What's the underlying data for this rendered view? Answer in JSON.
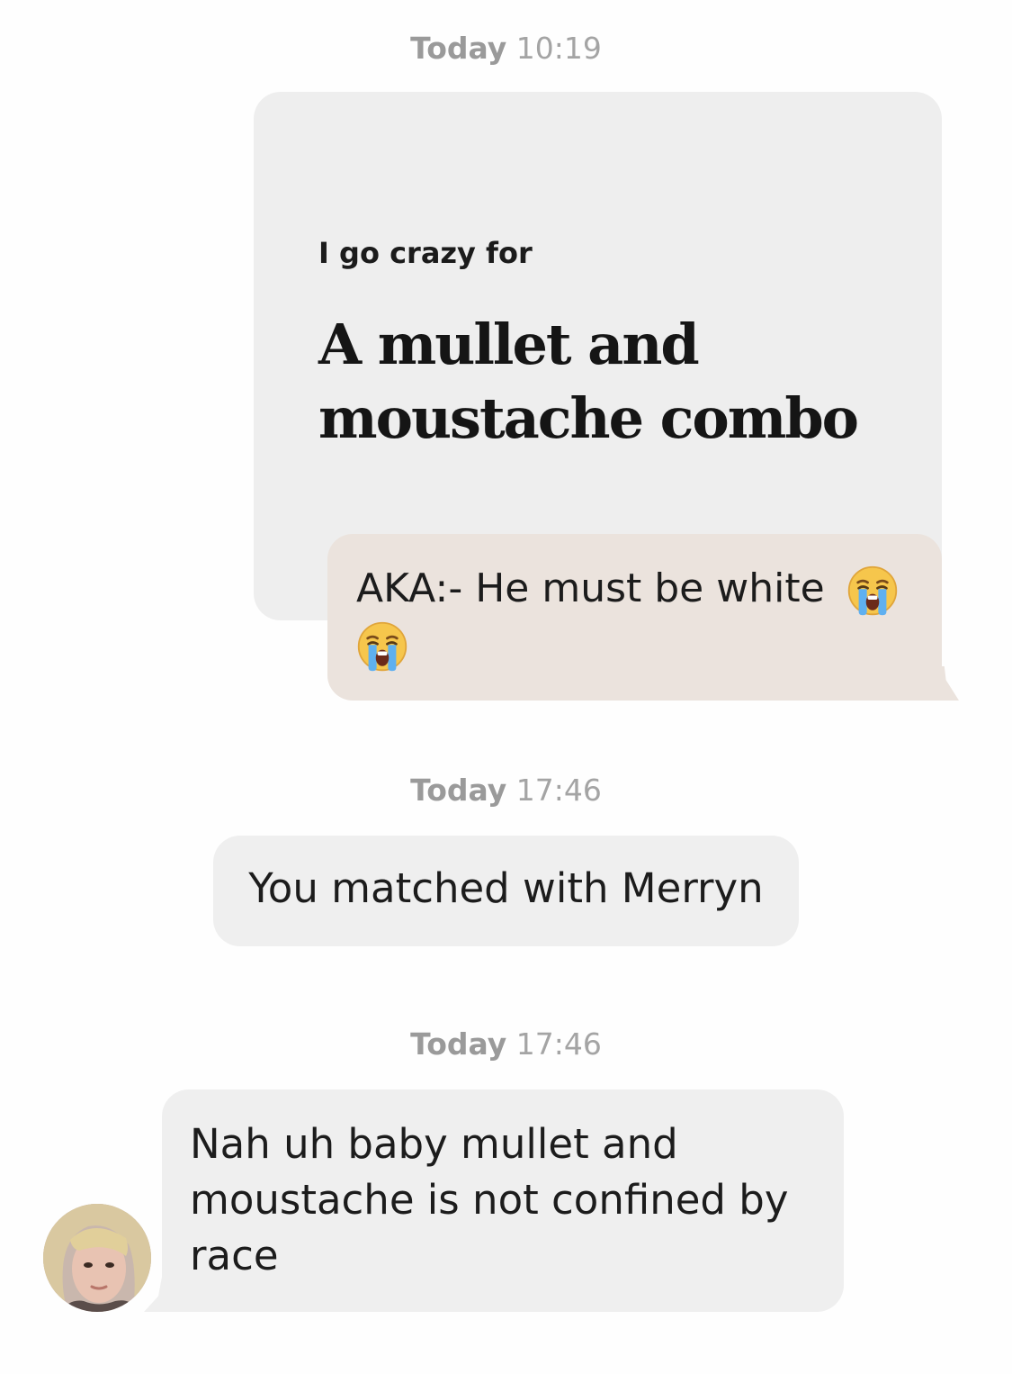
{
  "messages": {
    "ts1": {
      "day": "Today",
      "time": "10:19"
    },
    "prompt": {
      "question": "I go crazy for",
      "answer": "A mullet and moustache combo"
    },
    "reply": {
      "text": "AKA:- He must be white",
      "emojis": [
        "loudly-crying-face",
        "loudly-crying-face"
      ]
    },
    "ts2": {
      "day": "Today",
      "time": "17:46"
    },
    "system": {
      "text": "You matched with Merryn"
    },
    "ts3": {
      "day": "Today",
      "time": "17:46"
    },
    "received": {
      "text": "Nah uh baby mullet and moustache is not confined by race",
      "avatar": "match-avatar"
    }
  },
  "colors": {
    "sent_bubble": "#ebe3dd",
    "received_bubble": "#efefef",
    "prompt_card": "#eeeeee",
    "timestamp": "#a4a4a4"
  }
}
